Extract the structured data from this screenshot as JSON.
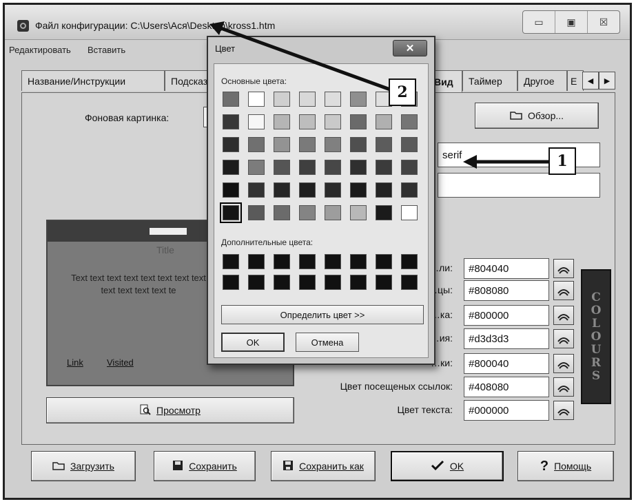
{
  "window": {
    "title": "Файл конфигурации: C:\\Users\\Ася\\Desktop\\kross1.htm",
    "minimize_glyph": "▭",
    "maximize_glyph": "▣",
    "close_glyph": "☒"
  },
  "menu": {
    "items": [
      "Редактировать",
      "Вставить"
    ]
  },
  "tabs": [
    "Название/Инструкции",
    "Подсказки",
    "Вид",
    "Таймер",
    "Другое",
    "Е"
  ],
  "tab_scroll": {
    "left": "◀",
    "right": "▶"
  },
  "settings": {
    "bg_image_label": "Фоновая картинка:",
    "browse_label": "Обзор...",
    "font_value": "serif",
    "font_size_value": ""
  },
  "preview": {
    "title": "Title",
    "body_text": "Text text text text text text text text text text text text te",
    "link": "Link",
    "visited": "Visited",
    "button_label": "Просмотр"
  },
  "colors": [
    {
      "label": "…ли:",
      "value": "#804040"
    },
    {
      "label": "…цы:",
      "value": "#808080"
    },
    {
      "label": "…ка:",
      "value": "#800000"
    },
    {
      "label": "…ия:",
      "value": "#d3d3d3"
    },
    {
      "label": "…ки:",
      "value": "#800040"
    },
    {
      "label": "Цвет посещеных ссылок:",
      "value": "#408080"
    },
    {
      "label": "Цвет текста:",
      "value": "#000000"
    }
  ],
  "colours_banner": [
    "C",
    "O",
    "L",
    "O",
    "U",
    "R",
    "S"
  ],
  "bottom_buttons": {
    "load": "Загрузить",
    "save": "Сохранить",
    "save_as": "Сохранить как",
    "ok": "OK",
    "help": "Помощь"
  },
  "color_dialog": {
    "title": "Цвет",
    "close_glyph": "✕",
    "basic_label": "Основные цвета:",
    "custom_label": "Дополнительные цвета:",
    "define_button": "Определить цвет >>",
    "ok_button": "OK",
    "cancel_button": "Отмена",
    "basic_colors": [
      "#6e6e6e",
      "#ffffff",
      "#cfcfcf",
      "#d8d8d8",
      "#dddddd",
      "#8f8f8f",
      "#e0e0e0",
      "#9a9a9a",
      "#383838",
      "#f6f6f6",
      "#b5b5b5",
      "#bdbdbd",
      "#c9c9c9",
      "#6a6a6a",
      "#b0b0b0",
      "#757575",
      "#2e2e2e",
      "#707070",
      "#939393",
      "#7a7a7a",
      "#808080",
      "#4f4f4f",
      "#5c5c5c",
      "#5a5a5a",
      "#1c1c1c",
      "#7c7c7c",
      "#555555",
      "#3f3f3f",
      "#474747",
      "#2f2f2f",
      "#3b3b3b",
      "#434343",
      "#111111",
      "#333333",
      "#262626",
      "#1f1f1f",
      "#2a2a2a",
      "#1a1a1a",
      "#232323",
      "#303030",
      "#141414",
      "#5a5a5a",
      "#6b6b6b",
      "#848484",
      "#9d9d9d",
      "#b8b8b8",
      "#1b1b1b",
      "#ffffff"
    ],
    "custom_colors": [
      "#111111",
      "#111111",
      "#111111",
      "#111111",
      "#111111",
      "#111111",
      "#111111",
      "#111111",
      "#111111",
      "#111111",
      "#111111",
      "#111111",
      "#111111",
      "#111111",
      "#111111",
      "#111111"
    ],
    "selected_index": 40
  },
  "callouts": [
    "1",
    "2"
  ]
}
